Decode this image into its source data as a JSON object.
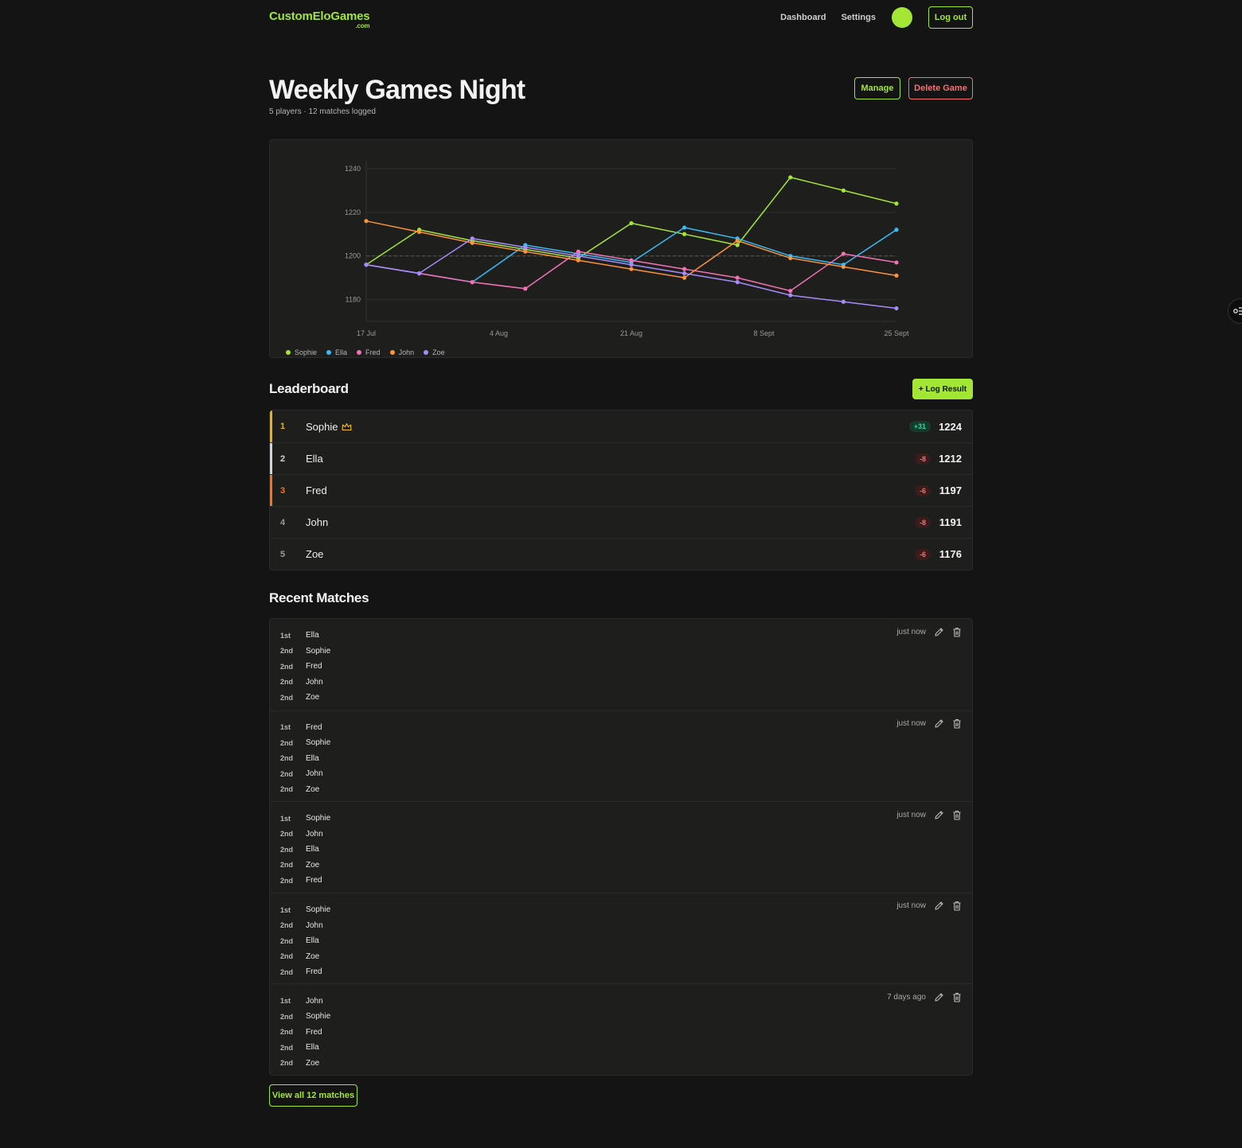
{
  "header": {
    "logo": "CustomEloGames",
    "logo_suffix": ".com",
    "nav": [
      "Dashboard",
      "Settings"
    ],
    "logout_label": "Log out"
  },
  "game": {
    "title": "Weekly Games Night",
    "subtitle": "5 players · 12 matches logged",
    "manage_label": "Manage",
    "delete_label": "Delete Game"
  },
  "chart_data": {
    "type": "line",
    "x": [
      "17 Jul",
      "24 Jul",
      "31 Jul",
      "4 Aug",
      "14 Aug",
      "21 Aug",
      "28 Aug",
      "4 Sept",
      "8 Sept",
      "18 Sept",
      "25 Sept"
    ],
    "x_ticks": [
      "17 Jul",
      "4 Aug",
      "21 Aug",
      "8 Sept",
      "25 Sept"
    ],
    "y_ticks": [
      1180,
      1200,
      1220,
      1240
    ],
    "ylim": [
      1170,
      1244
    ],
    "reference_line": 1200,
    "series": [
      {
        "name": "Sophie",
        "color": "#a3e635",
        "values": [
          1196,
          1212,
          1207,
          1203,
          1199,
          1215,
          1210,
          1205,
          1236,
          1230,
          1224
        ]
      },
      {
        "name": "Ella",
        "color": "#38bdf8",
        "values": [
          1196,
          1192,
          1188,
          1205,
          1201,
          1197,
          1213,
          1208,
          1200,
          1196,
          1212
        ]
      },
      {
        "name": "Fred",
        "color": "#f472b6",
        "values": [
          1196,
          1192,
          1188,
          1185,
          1202,
          1198,
          1194,
          1190,
          1184,
          1201,
          1197
        ]
      },
      {
        "name": "John",
        "color": "#fb923c",
        "values": [
          1216,
          1211,
          1206,
          1202,
          1198,
          1194,
          1190,
          1207,
          1199,
          1195,
          1191
        ]
      },
      {
        "name": "Zoe",
        "color": "#a78bfa",
        "values": [
          1196,
          1192,
          1208,
          1204,
          1200,
          1196,
          1192,
          1188,
          1182,
          1179,
          1176
        ]
      }
    ]
  },
  "leaderboard": {
    "title": "Leaderboard",
    "log_label": "+ Log Result",
    "rows": [
      {
        "rank": "1",
        "name": "Sophie",
        "delta": "+31",
        "elo": "1224",
        "bar": "#eab308",
        "rank_color": "#eab308",
        "crown": true,
        "positive": true
      },
      {
        "rank": "2",
        "name": "Ella",
        "delta": "-8",
        "elo": "1212",
        "bar": "#cbd5e1",
        "rank_color": "#d4d4d4",
        "crown": false,
        "positive": false
      },
      {
        "rank": "3",
        "name": "Fred",
        "delta": "-6",
        "elo": "1197",
        "bar": "#f97316",
        "rank_color": "#f97316",
        "crown": false,
        "positive": false
      },
      {
        "rank": "4",
        "name": "John",
        "delta": "-8",
        "elo": "1191",
        "bar": "",
        "rank_color": "#9a9a9a",
        "crown": false,
        "positive": false
      },
      {
        "rank": "5",
        "name": "Zoe",
        "delta": "-6",
        "elo": "1176",
        "bar": "",
        "rank_color": "#9a9a9a",
        "crown": false,
        "positive": false
      }
    ]
  },
  "recent": {
    "title": "Recent Matches",
    "matches": [
      {
        "time": "just now",
        "players": [
          [
            "1st",
            "Ella"
          ],
          [
            "2nd",
            "Sophie"
          ],
          [
            "2nd",
            "Fred"
          ],
          [
            "2nd",
            "John"
          ],
          [
            "2nd",
            "Zoe"
          ]
        ]
      },
      {
        "time": "just now",
        "players": [
          [
            "1st",
            "Fred"
          ],
          [
            "2nd",
            "Sophie"
          ],
          [
            "2nd",
            "Ella"
          ],
          [
            "2nd",
            "John"
          ],
          [
            "2nd",
            "Zoe"
          ]
        ]
      },
      {
        "time": "just now",
        "players": [
          [
            "1st",
            "Sophie"
          ],
          [
            "2nd",
            "John"
          ],
          [
            "2nd",
            "Ella"
          ],
          [
            "2nd",
            "Zoe"
          ],
          [
            "2nd",
            "Fred"
          ]
        ]
      },
      {
        "time": "just now",
        "players": [
          [
            "1st",
            "Sophie"
          ],
          [
            "2nd",
            "John"
          ],
          [
            "2nd",
            "Ella"
          ],
          [
            "2nd",
            "Zoe"
          ],
          [
            "2nd",
            "Fred"
          ]
        ]
      },
      {
        "time": "7 days ago",
        "players": [
          [
            "1st",
            "John"
          ],
          [
            "2nd",
            "Sophie"
          ],
          [
            "2nd",
            "Fred"
          ],
          [
            "2nd",
            "Ella"
          ],
          [
            "2nd",
            "Zoe"
          ]
        ]
      }
    ],
    "view_all_label": "View all 12 matches"
  }
}
